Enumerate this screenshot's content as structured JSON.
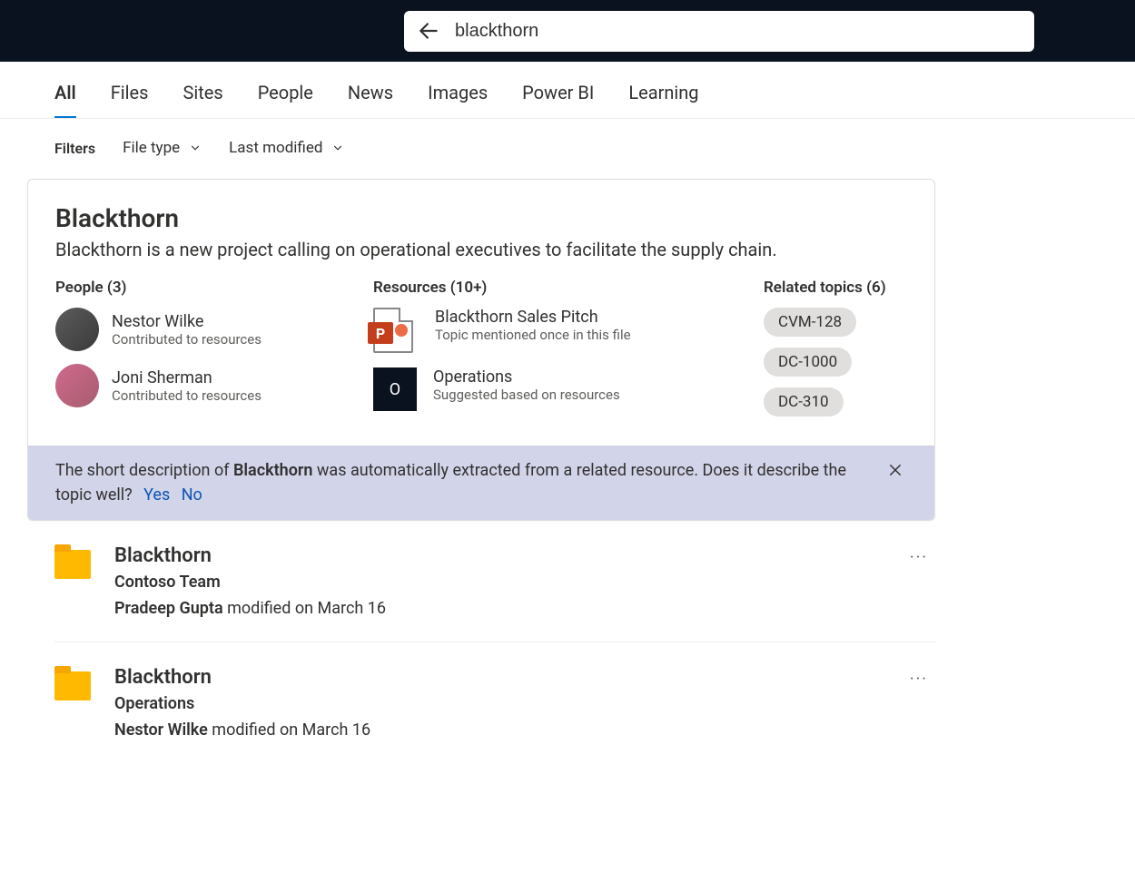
{
  "search": {
    "query": "blackthorn"
  },
  "tabs": [
    "All",
    "Files",
    "Sites",
    "People",
    "News",
    "Images",
    "Power BI",
    "Learning"
  ],
  "activeTab": 0,
  "filters": {
    "label": "Filters",
    "filetype": "File type",
    "lastmod": "Last modified"
  },
  "answer": {
    "title": "Blackthorn",
    "description": "Blackthorn is a new project calling on operational executives to facilitate the supply chain.",
    "people_heading": "People (3)",
    "people": [
      {
        "name": "Nestor Wilke",
        "sub": "Contributed to resources"
      },
      {
        "name": "Joni Sherman",
        "sub": "Contributed to resources"
      }
    ],
    "resources_heading": "Resources (10+)",
    "resources": [
      {
        "title": "Blackthorn Sales Pitch",
        "sub": "Topic mentioned once in this file",
        "iconLetter": "P",
        "iconType": "ppt"
      },
      {
        "title": "Operations",
        "sub": "Suggested based on resources",
        "iconLetter": "O",
        "iconType": "site"
      }
    ],
    "topics_heading": "Related topics (6)",
    "topics": [
      "CVM-128",
      "DC-1000",
      "DC-310"
    ],
    "feedback": {
      "pre": "The short description of ",
      "strong": "Blackthorn",
      "post": " was automatically extracted from a related resource. Does it describe the topic well?",
      "yes": "Yes",
      "no": "No"
    }
  },
  "results": [
    {
      "title": "Blackthorn",
      "location": "Contoso Team",
      "author": "Pradeep Gupta",
      "modified": "modified on March 16"
    },
    {
      "title": "Blackthorn",
      "location": "Operations",
      "author": "Nestor Wilke",
      "modified": "modified on March 16"
    }
  ]
}
